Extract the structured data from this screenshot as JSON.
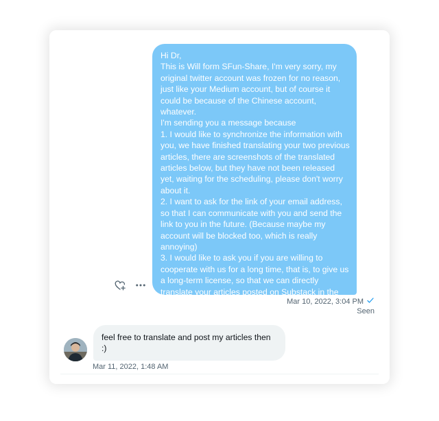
{
  "conversation": {
    "sent_message": {
      "text": "Hi Dr,\nThis is Will form SFun-Share, I'm very sorry, my original twitter account was frozen for no reason, just like your Medium account, but of course it could be because of the Chinese account, whatever.\nI'm sending you a message because\n1. I would like to synchronize the information with you, we have finished translating your two previous articles, there are screenshots of the translated articles below, but they have not been released yet, waiting for the scheduling, please don't worry about it.\n2. I want to ask for the link of your email address, so that I can communicate with you and send the link to you in the future. (Because maybe my account will be blocked too, which is really annoying)\n3. I would like to ask you if you are willing to cooperate with us for a long time, that is, to give us a long-term license, so that we can directly translate your articles posted on Substack in the future and post the link to you after the translation is finished.",
      "timestamp": "Mar 10, 2022, 3:04 PM",
      "status": "Seen",
      "bubble_color": "#7cc8f8"
    },
    "received_message": {
      "text": "feel free to translate and post my articles then\n:)",
      "timestamp": "Mar 11, 2022, 1:48 AM",
      "bubble_color": "#eff3f4"
    },
    "icons": {
      "react": "heart-plus-icon",
      "more": "more-dots-icon",
      "seen_check": "check-icon"
    }
  }
}
